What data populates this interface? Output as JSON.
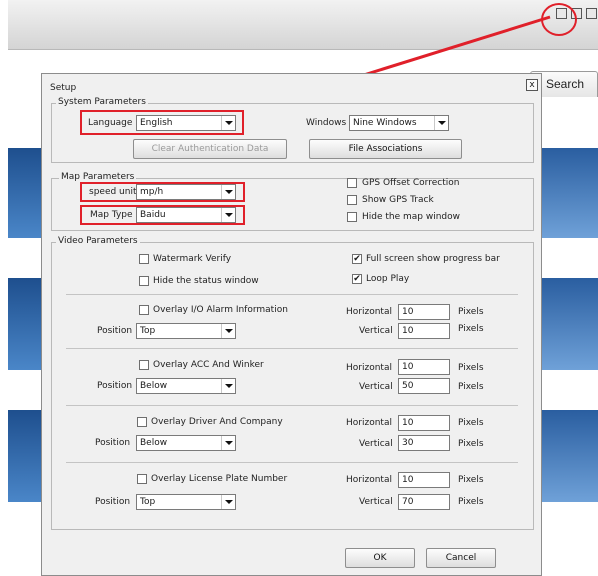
{
  "background": {
    "search_tab": "Search"
  },
  "dialog": {
    "title": "Setup",
    "close": "x",
    "system": {
      "legend": "System Parameters",
      "language_label": "Language",
      "language_value": "English",
      "windows_label": "Windows",
      "windows_value": "Nine Windows",
      "clear_auth": "Clear Authentication Data",
      "file_assoc": "File Associations"
    },
    "map": {
      "legend": "Map Parameters",
      "speed_label": "speed unit",
      "speed_value": "mp/h",
      "maptype_label": "Map Type",
      "maptype_value": "Baidu",
      "gps_offset": "GPS Offset Correction",
      "show_gps": "Show GPS Track",
      "hide_map": "Hide the map window"
    },
    "video": {
      "legend": "Video Parameters",
      "watermark": "Watermark Verify",
      "hide_status": "Hide the status window",
      "fullscreen": "Full screen show progress bar",
      "loop_play": "Loop Play",
      "position_label": "Position",
      "horizontal_label": "Horizontal",
      "vertical_label": "Vertical",
      "pixels_label": "Pixels",
      "check_mark": "✔",
      "overlays": [
        {
          "label": "Overlay I/O Alarm Information",
          "position": "Top",
          "horizontal": "10",
          "vertical": "10"
        },
        {
          "label": "Overlay ACC And Winker",
          "position": "Below",
          "horizontal": "10",
          "vertical": "50"
        },
        {
          "label": "Overlay Driver And Company",
          "position": "Below",
          "horizontal": "10",
          "vertical": "30"
        },
        {
          "label": "Overlay License Plate Number",
          "position": "Top",
          "horizontal": "10",
          "vertical": "70"
        }
      ]
    },
    "ok": "OK",
    "cancel": "Cancel"
  },
  "colors": {
    "highlight_red": "#e0202a",
    "dialog_bg": "#f0f0f0"
  }
}
